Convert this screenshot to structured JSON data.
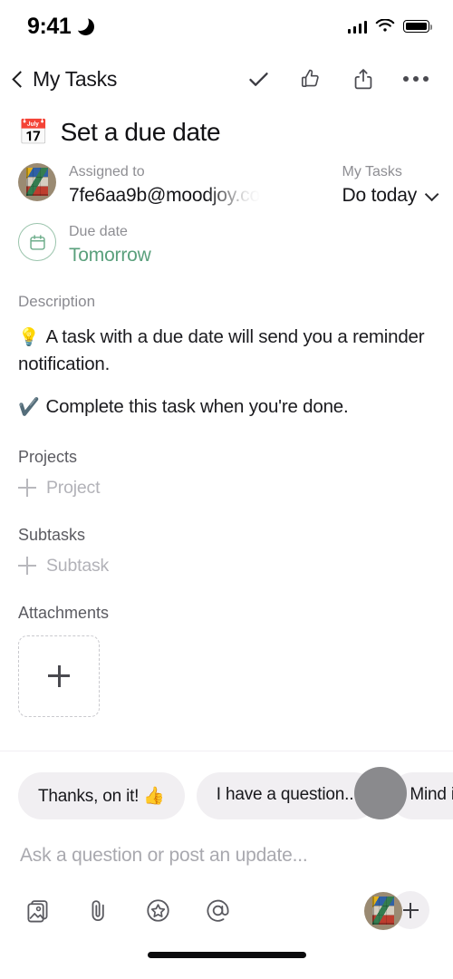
{
  "statusbar": {
    "time": "9:41",
    "moon_icon": "crescent-moon",
    "signal_icon": "cellular-bars",
    "wifi_icon": "wifi",
    "battery_icon": "battery-full"
  },
  "navbar": {
    "back_label": "My Tasks",
    "actions": [
      {
        "name": "complete-task",
        "icon": "check-icon"
      },
      {
        "name": "like-task",
        "icon": "thumbs-up-icon"
      },
      {
        "name": "share-task",
        "icon": "share-icon"
      },
      {
        "name": "more-options",
        "icon": "ellipsis-icon"
      }
    ]
  },
  "task": {
    "emoji": "📅",
    "title": "Set a due date",
    "assignee": {
      "label": "Assigned to",
      "value": "7fe6aa9b@moodjoy.co"
    },
    "project": {
      "label": "My Tasks",
      "value": "Do today"
    },
    "due": {
      "label": "Due date",
      "value": "Tomorrow",
      "color": "#5aa07c"
    }
  },
  "description": {
    "section_label": "Description",
    "lines": [
      {
        "emoji": "💡",
        "text": "A task with a due date will send you a reminder notification."
      },
      {
        "emoji": "✔️",
        "text": "Complete this task when you're done."
      }
    ]
  },
  "projects": {
    "header": "Projects",
    "add_label": "Project"
  },
  "subtasks": {
    "header": "Subtasks",
    "add_label": "Subtask"
  },
  "attachments": {
    "header": "Attachments",
    "add_icon": "plus-icon"
  },
  "quick_replies": [
    {
      "label": "Thanks, on it! 👍"
    },
    {
      "label": "I have a question..."
    },
    {
      "label": "Mind if I ch"
    }
  ],
  "composer": {
    "placeholder": "Ask a question or post an update...",
    "tools": [
      {
        "name": "photo-library",
        "icon": "image-stack-icon"
      },
      {
        "name": "attach-file",
        "icon": "paperclip-icon"
      },
      {
        "name": "add-sticker",
        "icon": "star-circle-icon"
      },
      {
        "name": "mention-user",
        "icon": "at-sign-icon"
      }
    ],
    "add_collaborator_icon": "plus-icon"
  }
}
